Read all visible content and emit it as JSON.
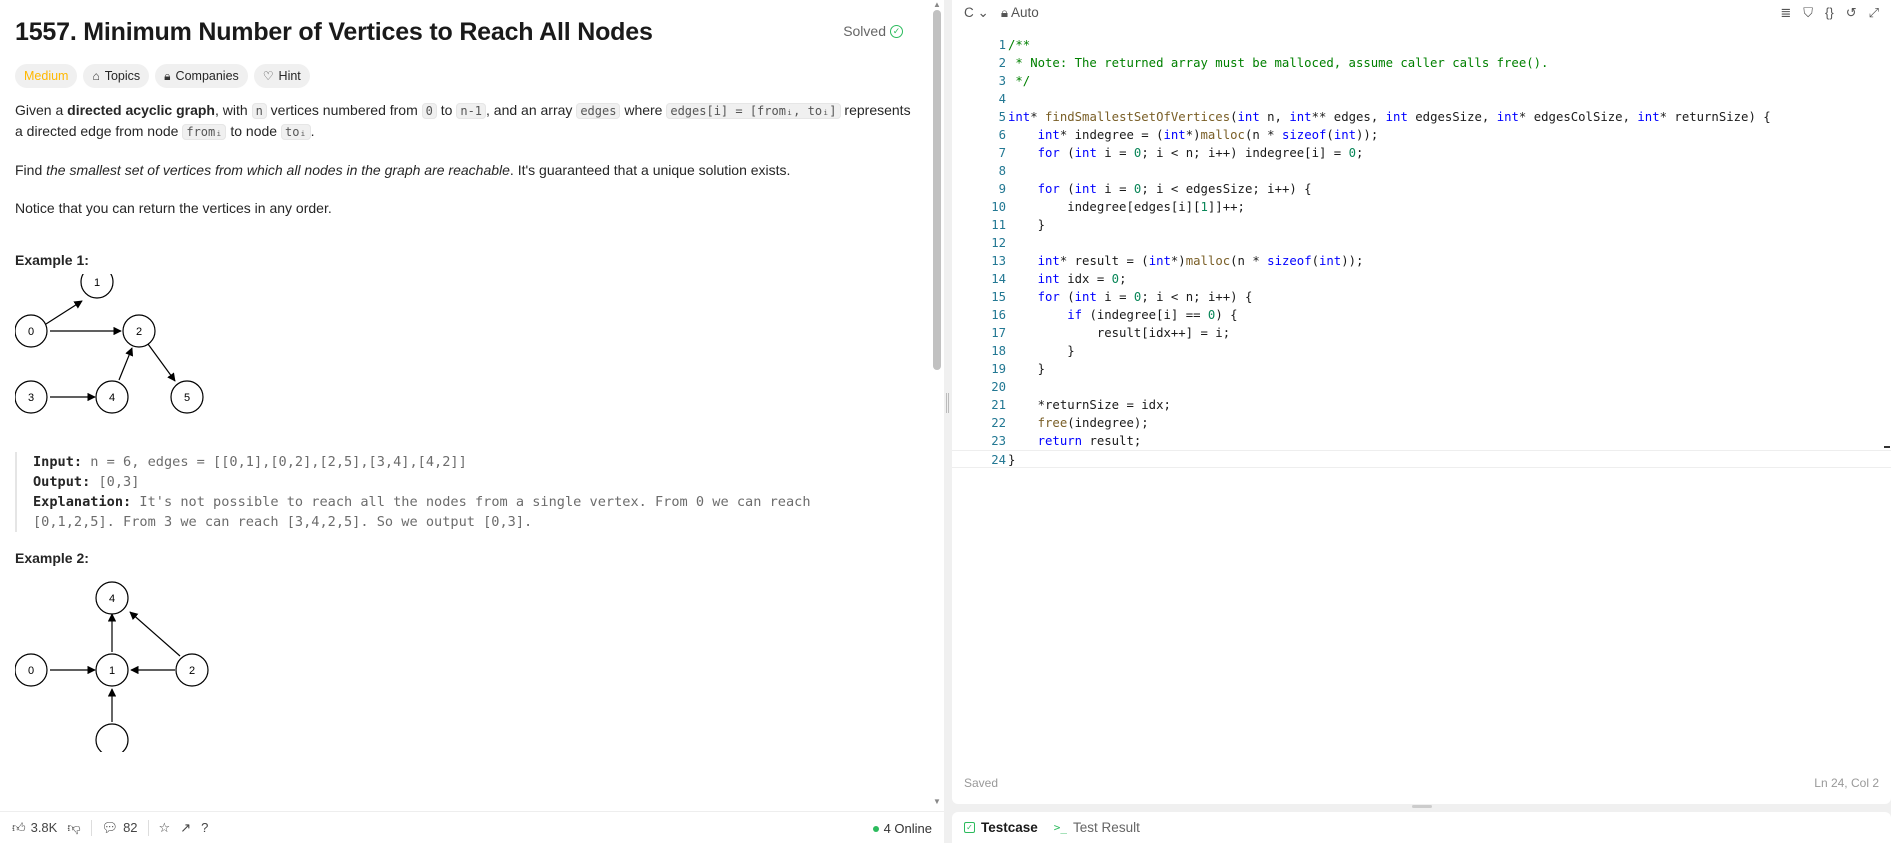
{
  "problem": {
    "title": "1557. Minimum Number of Vertices to Reach All Nodes",
    "status": "Solved",
    "tags": [
      "Medium",
      "Topics",
      "Companies",
      "Hint"
    ],
    "desc1": {
      "a": "Given a ",
      "b": "directed acyclic graph",
      "c": ", with ",
      "n": "n",
      "d": " vertices numbered from ",
      "zero": "0",
      "e": " to ",
      "nm1": "n-1",
      "f": ", and an array ",
      "edges": "edges",
      "g": " where ",
      "edgei": "edges[i] = [fromᵢ, toᵢ]",
      "h": " represents a directed edge from node ",
      "from": "fromᵢ",
      "i": " to node ",
      "to": "toᵢ",
      "j": "."
    },
    "desc2": {
      "a": "Find ",
      "b": "the smallest set of vertices from which all nodes in the graph are reachable",
      "c": ". It's guaranteed that a unique solution exists."
    },
    "desc3": "Notice that you can return the vertices in any order.",
    "example1": {
      "title": "Example 1:",
      "input_label": "Input:",
      "input": " n = 6, edges = [[0,1],[0,2],[2,5],[3,4],[4,2]]",
      "output_label": "Output:",
      "output": " [0,3]",
      "expl_label": "Explanation:",
      "expl": " It's not possible to reach all the nodes from a single vertex. From 0 we can reach [0,1,2,5]. From 3 we can reach [3,4,2,5]. So we output [0,3].",
      "nodes": [
        "1",
        "0",
        "2",
        "3",
        "4",
        "5"
      ]
    },
    "example2": {
      "title": "Example 2:",
      "nodes": [
        "4",
        "0",
        "1",
        "2"
      ]
    }
  },
  "footer": {
    "likes": "3.8K",
    "comments": "82",
    "online": "4 Online"
  },
  "editor": {
    "language": "C",
    "mode": "Auto",
    "saved": "Saved",
    "position": "Ln 24, Col 2"
  },
  "bottom_tabs": {
    "testcase": "Testcase",
    "result": "Test Result"
  }
}
